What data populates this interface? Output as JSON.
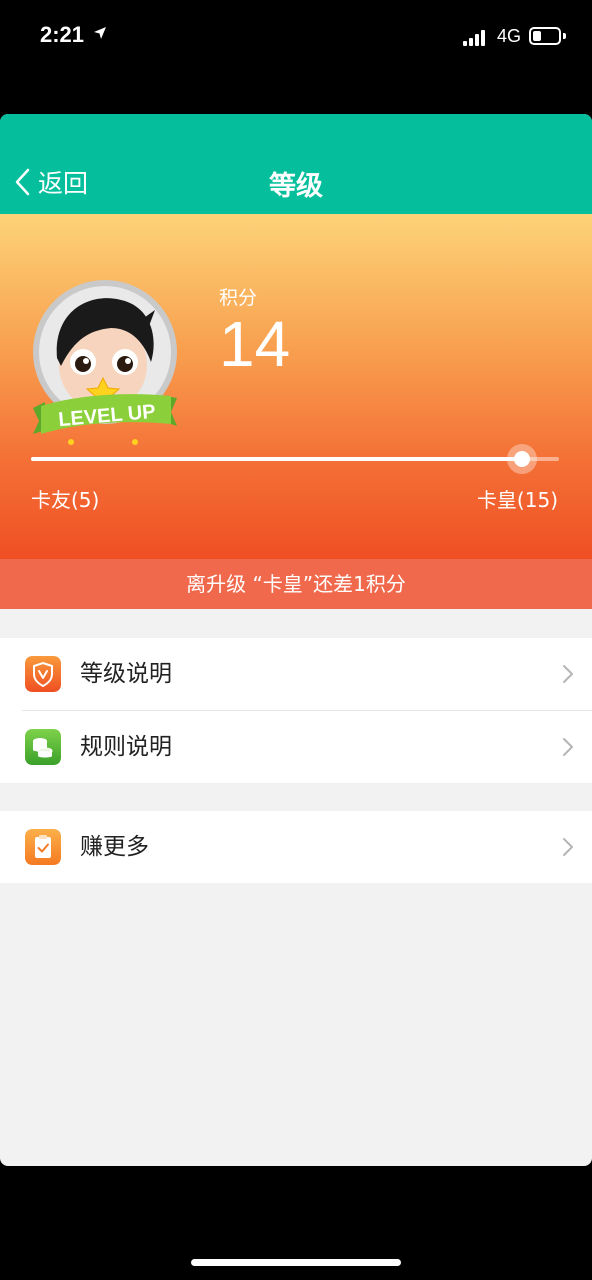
{
  "status": {
    "time": "2:21",
    "network": "4G",
    "battery_level": 0.35
  },
  "nav": {
    "back_label": "返回",
    "title": "等级"
  },
  "hero": {
    "avatar_badge": "LEVEL UP",
    "points_label": "积分",
    "points_value": "14",
    "progress_fraction": 0.93,
    "current_level": "卡友(5)",
    "next_level": "卡皇(15)"
  },
  "tip": "离升级 “卡皇”还差1积分",
  "menu": {
    "group1": [
      {
        "label": "等级说明",
        "icon": "shield-v-icon",
        "color": "#f26a2e"
      },
      {
        "label": "规则说明",
        "icon": "coins-icon",
        "color": "#4cb33a"
      }
    ],
    "group2": [
      {
        "label": "赚更多",
        "icon": "clipboard-check-icon",
        "color": "#f7852c"
      }
    ]
  },
  "colors": {
    "nav_bg": "#05bf9c",
    "tip_bg": "#f0694c"
  }
}
